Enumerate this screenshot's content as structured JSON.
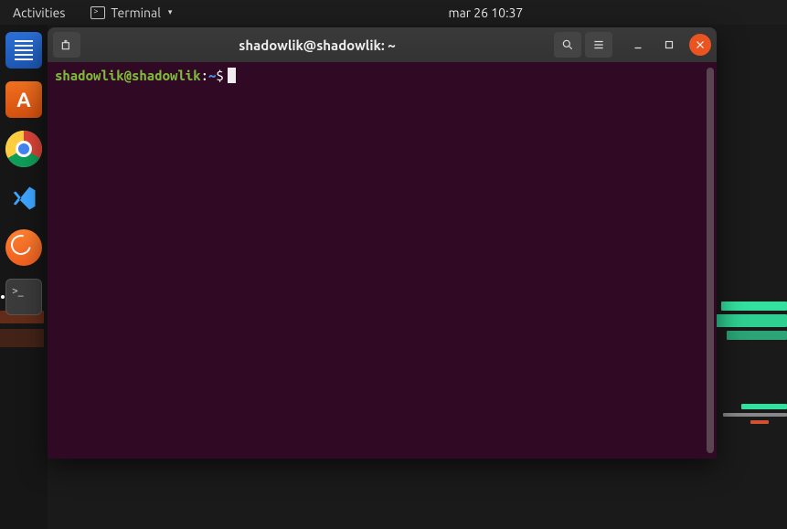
{
  "topbar": {
    "activities_label": "Activities",
    "app_name": "Terminal",
    "clock": "mar 26  10:37"
  },
  "launcher": {
    "items": [
      {
        "name": "text-editor",
        "active": false
      },
      {
        "name": "ubuntu-software",
        "active": false
      },
      {
        "name": "google-chrome",
        "active": false
      },
      {
        "name": "vscode",
        "active": false
      },
      {
        "name": "postman",
        "active": false
      },
      {
        "name": "terminal",
        "active": true
      }
    ]
  },
  "window": {
    "title": "shadowlik@shadowlik: ~",
    "buttons": {
      "new_tab": "new-tab",
      "search": "search",
      "menu": "menu",
      "minimize": "minimize",
      "maximize": "maximize",
      "close": "close"
    }
  },
  "terminal": {
    "prompt_user": "shadowlik@shadowlik",
    "prompt_separator": ":",
    "prompt_path": "~",
    "prompt_symbol": "$"
  }
}
